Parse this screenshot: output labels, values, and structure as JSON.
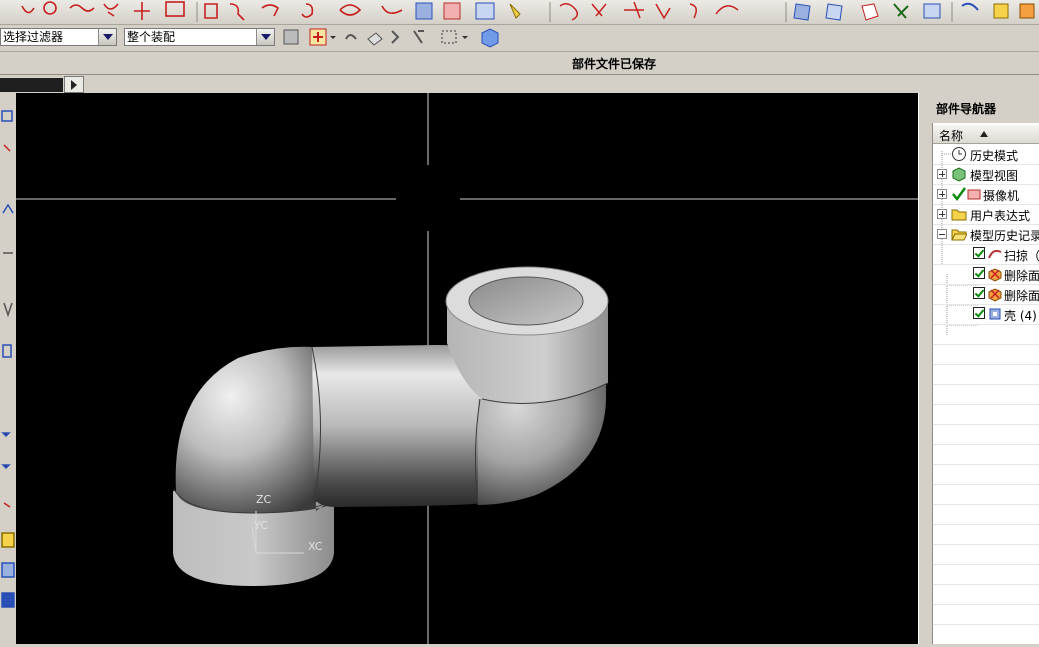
{
  "toolbar2": {
    "filter_value": "选择过滤器",
    "assembly_value": "整个装配"
  },
  "status": {
    "message": "部件文件已保存"
  },
  "viewport": {
    "triad": {
      "x": "XC",
      "y": "YC",
      "z": "ZC"
    }
  },
  "navigator": {
    "title": "部件导航器",
    "column_header": "名称",
    "rows": [
      {
        "label": "历史模式"
      },
      {
        "label": "模型视图"
      },
      {
        "label": "摄像机"
      },
      {
        "label": "用户表达式"
      },
      {
        "label": "模型历史记录"
      },
      {
        "label": "扫掠（"
      },
      {
        "label": "删除面"
      },
      {
        "label": "删除面"
      },
      {
        "label": "壳 (4)"
      }
    ]
  },
  "colors": {
    "chrome": "#d4d0c8",
    "viewport_bg": "#000000",
    "accent_blue": "#2a4fb8",
    "check_green": "#0a8a0a"
  }
}
